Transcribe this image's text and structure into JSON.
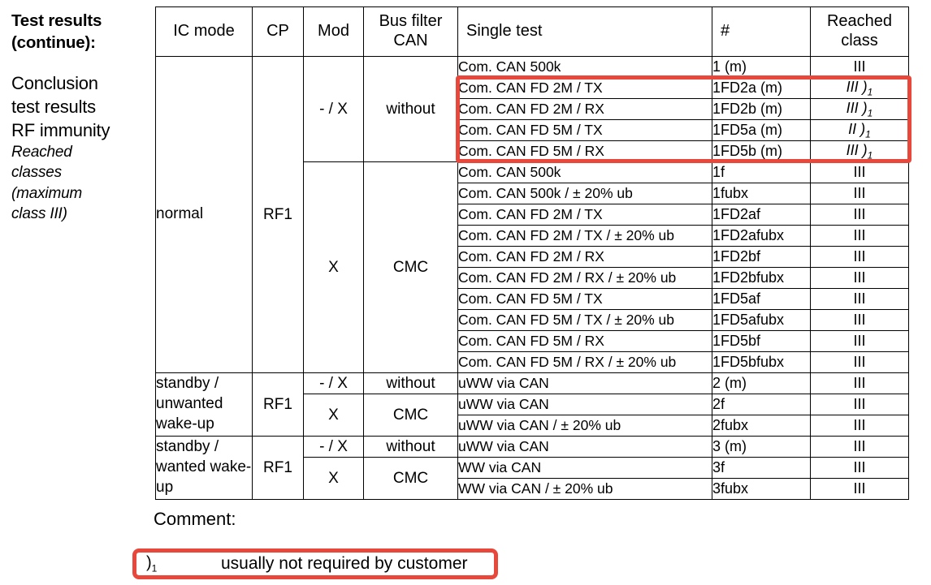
{
  "left_caption": {
    "title_lines": [
      "Test results",
      "(continue):"
    ],
    "subtitle_lines": [
      "Conclusion",
      "test results",
      "RF immunity"
    ],
    "italic_lines": [
      "Reached",
      "classes",
      "(maximum",
      "class III)"
    ]
  },
  "table": {
    "headers": {
      "ic_mode": "IC mode",
      "cp": "CP",
      "mod": "Mod",
      "bus_filter": "Bus filter CAN",
      "single_test": "Single test",
      "number": "#",
      "reached_class": "Reached class"
    },
    "groups": [
      {
        "ic_mode": "normal",
        "cp": "RF1",
        "blocks": [
          {
            "mod": "- / X",
            "bus_filter": "without",
            "rows": [
              {
                "single_test": "Com. CAN 500k",
                "number": "1 (m)",
                "reached_class": "III",
                "marker": "",
                "italic": false,
                "highlighted": false
              },
              {
                "single_test": "Com. CAN FD 2M / TX",
                "number": "1FD2a (m)",
                "reached_class": "III",
                "marker": ")1",
                "italic": true,
                "highlighted": true
              },
              {
                "single_test": "Com. CAN FD 2M / RX",
                "number": "1FD2b (m)",
                "reached_class": "III",
                "marker": ")1",
                "italic": true,
                "highlighted": true
              },
              {
                "single_test": "Com. CAN FD 5M / TX",
                "number": "1FD5a (m)",
                "reached_class": "II",
                "marker": ")1",
                "italic": true,
                "highlighted": true
              },
              {
                "single_test": "Com. CAN FD 5M / RX",
                "number": "1FD5b (m)",
                "reached_class": "III",
                "marker": ")1",
                "italic": true,
                "highlighted": true
              }
            ]
          },
          {
            "mod": "X",
            "bus_filter": "CMC",
            "rows": [
              {
                "single_test": "Com. CAN 500k",
                "number": "1f",
                "reached_class": "III",
                "marker": "",
                "italic": false,
                "highlighted": false
              },
              {
                "single_test": "Com. CAN 500k / ± 20% ub",
                "number": "1fubx",
                "reached_class": "III",
                "marker": "",
                "italic": false,
                "highlighted": false
              },
              {
                "single_test": "Com. CAN FD 2M / TX",
                "number": "1FD2af",
                "reached_class": "III",
                "marker": "",
                "italic": false,
                "highlighted": false
              },
              {
                "single_test": "Com. CAN FD 2M / TX / ± 20% ub",
                "number": "1FD2afubx",
                "reached_class": "III",
                "marker": "",
                "italic": false,
                "highlighted": false
              },
              {
                "single_test": "Com. CAN FD 2M / RX",
                "number": "1FD2bf",
                "reached_class": "III",
                "marker": "",
                "italic": false,
                "highlighted": false
              },
              {
                "single_test": "Com. CAN FD 2M / RX / ± 20% ub",
                "number": "1FD2bfubx",
                "reached_class": "III",
                "marker": "",
                "italic": false,
                "highlighted": false
              },
              {
                "single_test": "Com. CAN FD 5M / TX",
                "number": "1FD5af",
                "reached_class": "III",
                "marker": "",
                "italic": false,
                "highlighted": false
              },
              {
                "single_test": "Com. CAN FD 5M / TX / ± 20% ub",
                "number": "1FD5afubx",
                "reached_class": "III",
                "marker": "",
                "italic": false,
                "highlighted": false
              },
              {
                "single_test": "Com. CAN FD 5M / RX",
                "number": "1FD5bf",
                "reached_class": "III",
                "marker": "",
                "italic": false,
                "highlighted": false
              },
              {
                "single_test": "Com. CAN FD 5M / RX / ± 20% ub",
                "number": "1FD5bfubx",
                "reached_class": "III",
                "marker": "",
                "italic": false,
                "highlighted": false
              }
            ]
          }
        ]
      },
      {
        "ic_mode": "standby / unwanted wake-up",
        "cp": "RF1",
        "blocks": [
          {
            "mod": "- / X",
            "bus_filter": "without",
            "rows": [
              {
                "single_test": "uWW via CAN",
                "number": "2 (m)",
                "reached_class": "III",
                "marker": "",
                "italic": false,
                "highlighted": false
              }
            ]
          },
          {
            "mod": "X",
            "bus_filter": "CMC",
            "rows": [
              {
                "single_test": "uWW via CAN",
                "number": "2f",
                "reached_class": "III",
                "marker": "",
                "italic": false,
                "highlighted": false
              },
              {
                "single_test": "uWW via CAN / ± 20% ub",
                "number": "2fubx",
                "reached_class": "III",
                "marker": "",
                "italic": false,
                "highlighted": false
              }
            ]
          }
        ]
      },
      {
        "ic_mode": "standby / wanted wake-up",
        "cp": "RF1",
        "blocks": [
          {
            "mod": "- / X",
            "bus_filter": "without",
            "rows": [
              {
                "single_test": "uWW via CAN",
                "number": "3 (m)",
                "reached_class": "III",
                "marker": "",
                "italic": false,
                "highlighted": false
              }
            ]
          },
          {
            "mod": "X",
            "bus_filter": "CMC",
            "rows": [
              {
                "single_test": "WW via CAN",
                "number": "3f",
                "reached_class": "III",
                "marker": "",
                "italic": false,
                "highlighted": false
              },
              {
                "single_test": "WW via CAN / ± 20% ub",
                "number": "3fubx",
                "reached_class": "III",
                "marker": "",
                "italic": false,
                "highlighted": false
              }
            ]
          }
        ]
      }
    ]
  },
  "comment": {
    "label": "Comment:",
    "marker": ")1",
    "text": "usually not required by customer"
  },
  "colors": {
    "highlight_red": "#e8473c",
    "table_border": "#000000",
    "text": "#000000"
  }
}
